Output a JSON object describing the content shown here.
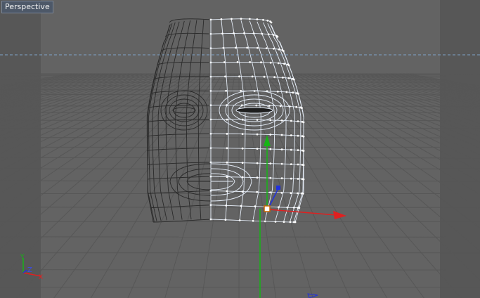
{
  "viewport": {
    "label": "Perspective"
  },
  "axis_indicator": {
    "y_label": "Y",
    "z_label": "Z",
    "x_label": "X"
  },
  "colors": {
    "background": "#626262",
    "grid": "#555555",
    "mesh_left": "#2a2a2a",
    "mesh_right_selected": "#dfe8f5",
    "axis_x": "#e02020",
    "axis_y": "#16b416",
    "axis_z": "#2030e0",
    "horizon_line": "#7fa3c8",
    "label_bg": "#4d5868"
  }
}
